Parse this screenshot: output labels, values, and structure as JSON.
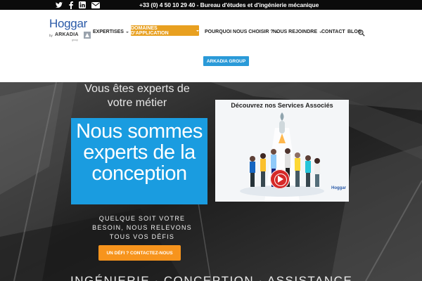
{
  "topbar": {
    "phone_text": "+33 (0) 4 50 10 29 40 - Bureau d'études et d'ingénierie mécanique",
    "socials": [
      "twitter-icon",
      "facebook-icon",
      "linkedin-icon",
      "email-icon"
    ]
  },
  "logo": {
    "name": "Hoggar",
    "by": "by",
    "brand": "ARKADIA",
    "sub": "group"
  },
  "nav": {
    "items": [
      {
        "label": "EXPERTISES"
      },
      {
        "label": "DOMAINES D'APPLICATION"
      },
      {
        "label": "POURQUOI NOUS CHOISIR ?"
      },
      {
        "label": "NOUS REJOINDRE"
      },
      {
        "label": "CONTACT"
      },
      {
        "label": "BLOG"
      }
    ],
    "group_button": "ARKADIA GROUP"
  },
  "hero": {
    "subtitle": "Vous êtes experts de votre métier",
    "title": "Nous sommes experts de la conception",
    "tagline": "QUELQUE SOIT VOTRE BESOIN, NOUS RELEVONS TOUS VOS DÉFIS",
    "cta": "UN DÉFI ? CONTACTEZ-NOUS",
    "video_title": "Découvrez nos Services Associés",
    "video_logo": "Hoggar",
    "bottom_text": "INGÉNIERIE · CONCEPTION · ASSISTANCE"
  },
  "colors": {
    "accent_orange": "#e8a020",
    "cta_orange": "#f7941d",
    "blue": "#1a9ce0",
    "brand_blue": "#2a5aa8",
    "topbar": "#0b0b0b"
  }
}
